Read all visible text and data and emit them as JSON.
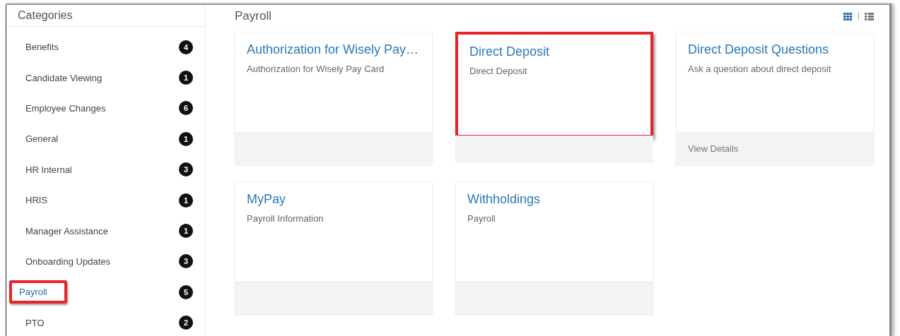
{
  "sidebar": {
    "title": "Categories",
    "items": [
      {
        "label": "Benefits",
        "count": "4",
        "selected": false,
        "highlighted": false
      },
      {
        "label": "Candidate Viewing",
        "count": "1",
        "selected": false,
        "highlighted": false
      },
      {
        "label": "Employee Changes",
        "count": "6",
        "selected": false,
        "highlighted": false
      },
      {
        "label": "General",
        "count": "1",
        "selected": false,
        "highlighted": false
      },
      {
        "label": "HR Internal",
        "count": "3",
        "selected": false,
        "highlighted": false
      },
      {
        "label": "HRIS",
        "count": "1",
        "selected": false,
        "highlighted": false
      },
      {
        "label": "Manager Assistance",
        "count": "1",
        "selected": false,
        "highlighted": false
      },
      {
        "label": "Onboarding Updates",
        "count": "3",
        "selected": false,
        "highlighted": false
      },
      {
        "label": "Payroll",
        "count": "5",
        "selected": true,
        "highlighted": true
      },
      {
        "label": "PTO",
        "count": "2",
        "selected": false,
        "highlighted": false
      }
    ]
  },
  "main": {
    "title": "Payroll",
    "view_toggles": [
      {
        "kind": "grid",
        "selected": true
      },
      {
        "kind": "list",
        "selected": false
      }
    ],
    "cards": [
      {
        "title": "Authorization for Wisely Pay…",
        "description": "Authorization for Wisely Pay Card",
        "highlighted": false
      },
      {
        "title": "Direct Deposit",
        "description": "Direct Deposit",
        "highlighted": true
      },
      {
        "title": "Direct Deposit Questions",
        "description": "Ask a question about direct deposit",
        "footer": "View Details",
        "highlighted": false
      },
      {
        "title": "MyPay",
        "description": "Payroll Information",
        "highlighted": false
      },
      {
        "title": "Withholdings",
        "description": "Payroll",
        "highlighted": false
      }
    ]
  }
}
